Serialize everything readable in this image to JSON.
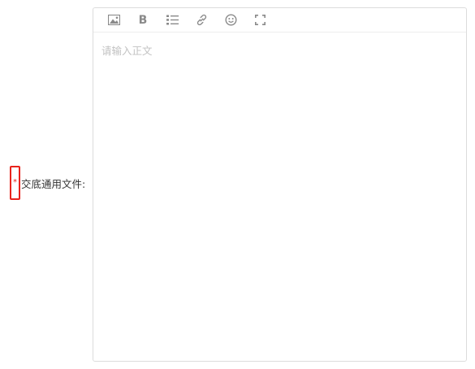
{
  "form": {
    "required_mark": "*",
    "label": "交底通用文件:"
  },
  "editor": {
    "placeholder": "请输入正文",
    "toolbar": {
      "tools": [
        "image-icon",
        "bold-icon",
        "bulleted-list-icon",
        "link-icon",
        "emoji-icon",
        "fullscreen-icon"
      ],
      "bold_glyph": "B"
    }
  }
}
